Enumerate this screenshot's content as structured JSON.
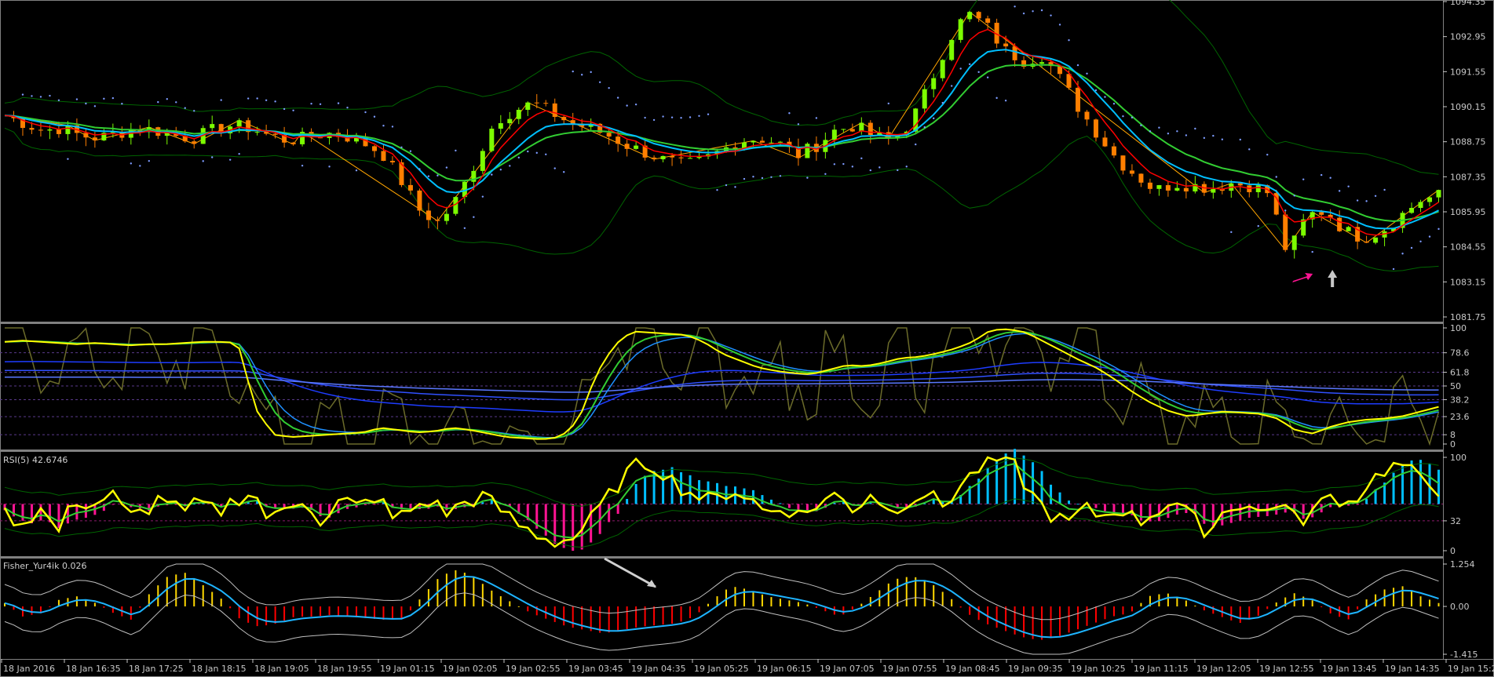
{
  "chart_data": {
    "type": "candlestick",
    "panels": [
      {
        "id": "price",
        "y_ticks": [
          "1094.35",
          "1092.95",
          "1091.55",
          "1090.15",
          "1088.75",
          "1087.35",
          "1085.95",
          "1084.55",
          "1083.15",
          "1081.75"
        ],
        "ylim": [
          1081.75,
          1094.35
        ]
      },
      {
        "id": "stoch",
        "y_ticks": [
          "100",
          "78.6",
          "61.8",
          "50",
          "38.2",
          "23.6",
          "8",
          "0"
        ],
        "ylim": [
          0,
          100
        ]
      },
      {
        "id": "rsi",
        "label": "RSI(5) 42.6746",
        "y_ticks": [
          "100",
          "32",
          "0"
        ],
        "ylim": [
          0,
          100
        ]
      },
      {
        "id": "fisher",
        "label": "Fisher_Yur4ik 0.026",
        "y_ticks": [
          "1.254",
          "0.00",
          "-1.415"
        ],
        "ylim": [
          -1.415,
          1.254
        ]
      }
    ],
    "x_ticks": [
      "18 Jan 2016",
      "18 Jan 16:35",
      "18 Jan 17:25",
      "18 Jan 18:15",
      "18 Jan 19:05",
      "18 Jan 19:55",
      "19 Jan 01:15",
      "19 Jan 02:05",
      "19 Jan 02:55",
      "19 Jan 03:45",
      "19 Jan 04:35",
      "19 Jan 05:25",
      "19 Jan 06:15",
      "19 Jan 07:05",
      "19 Jan 07:55",
      "19 Jan 08:45",
      "19 Jan 09:35",
      "19 Jan 10:25",
      "19 Jan 11:15",
      "19 Jan 12:05",
      "19 Jan 12:55",
      "19 Jan 13:45",
      "19 Jan 14:35",
      "19 Jan 15:25"
    ],
    "price_path": [
      1089.8,
      1089.5,
      1089.2,
      1089.3,
      1089.0,
      1088.9,
      1089.1,
      1089.3,
      1089.2,
      1089.0,
      1088.9,
      1089.2,
      1089.4,
      1089.3,
      1089.0,
      1088.8,
      1088.9,
      1089.1,
      1089.0,
      1088.7,
      1088.3,
      1087.2,
      1086.0,
      1085.5,
      1086.5,
      1088.0,
      1089.6,
      1090.0,
      1090.3,
      1089.9,
      1089.5,
      1089.3,
      1089.0,
      1088.6,
      1088.3,
      1088.0,
      1087.8,
      1088.0,
      1088.4,
      1088.8,
      1088.9,
      1088.7,
      1088.2,
      1088.6,
      1089.2,
      1089.4,
      1089.0,
      1088.8,
      1089.5,
      1091.0,
      1092.8,
      1093.9,
      1093.4,
      1092.4,
      1092.0,
      1092.2,
      1091.2,
      1090.0,
      1089.0,
      1088.0,
      1087.4,
      1086.8,
      1087.1,
      1087.0,
      1086.9,
      1087.1,
      1087.0,
      1086.7,
      1084.2,
      1085.8,
      1086.0,
      1085.2,
      1084.9,
      1085.2,
      1085.8,
      1086.4,
      1086.6
    ],
    "stoch_path": [
      88,
      89,
      88,
      87,
      86,
      87,
      86,
      85,
      86,
      86,
      87,
      88,
      88,
      87,
      30,
      8,
      6,
      7,
      8,
      9,
      10,
      14,
      12,
      10,
      11,
      14,
      12,
      9,
      6,
      5,
      4,
      6,
      20,
      60,
      85,
      97,
      96,
      95,
      94,
      88,
      78,
      72,
      66,
      63,
      61,
      60,
      64,
      68,
      67,
      70,
      74,
      75,
      78,
      82,
      88,
      98,
      99,
      96,
      88,
      80,
      72,
      65,
      55,
      44,
      35,
      28,
      24,
      26,
      28,
      27,
      26,
      22,
      12,
      9,
      15,
      19,
      21,
      22,
      24,
      28,
      32
    ],
    "rsi_path": [
      40,
      30,
      45,
      20,
      55,
      48,
      62,
      35,
      44,
      60,
      38,
      52,
      40,
      55,
      64,
      30,
      48,
      58,
      25,
      55,
      46,
      60,
      32,
      45,
      54,
      40,
      52,
      58,
      44,
      28,
      18,
      10,
      12,
      30,
      55,
      80,
      95,
      88,
      70,
      60,
      52,
      66,
      58,
      40,
      48,
      36,
      52,
      60,
      44,
      64,
      40,
      55,
      62,
      48,
      70,
      88,
      97,
      92,
      60,
      40,
      28,
      45,
      36,
      48,
      30,
      42,
      55,
      35,
      20,
      46,
      52,
      38,
      55,
      30,
      44,
      60,
      50,
      72,
      88,
      92,
      74,
      66
    ],
    "fisher_path": [
      0.1,
      -0.3,
      -0.2,
      0.2,
      0.3,
      0.1,
      -0.2,
      -0.4,
      0.4,
      0.9,
      1.0,
      0.6,
      0.2,
      -0.4,
      -0.6,
      -0.5,
      -0.3,
      -0.3,
      -0.25,
      -0.3,
      -0.35,
      -0.4,
      -0.35,
      0.3,
      0.9,
      1.1,
      0.8,
      0.4,
      0.1,
      -0.2,
      -0.4,
      -0.6,
      -0.7,
      -0.8,
      -0.7,
      -0.6,
      -0.55,
      -0.5,
      -0.3,
      0.2,
      0.6,
      0.5,
      0.3,
      0.2,
      0.1,
      -0.1,
      -0.3,
      0.0,
      0.4,
      0.8,
      0.9,
      0.7,
      0.3,
      -0.2,
      -0.5,
      -0.7,
      -0.9,
      -1.0,
      -0.9,
      -0.7,
      -0.5,
      -0.3,
      -0.2,
      0.3,
      0.4,
      0.2,
      -0.1,
      -0.3,
      -0.5,
      -0.3,
      0.1,
      0.4,
      0.2,
      -0.2,
      -0.4,
      0.2,
      0.5,
      0.6,
      0.3,
      0.1
    ]
  },
  "colors": {
    "bull": "#7cfc00",
    "bear": "#ff7f00",
    "ma_red": "#ff0000",
    "ma_blue": "#00bfff",
    "ma_green": "#32cd32",
    "band": "#006400",
    "sar": "#7d9bff",
    "zigzag": "#ffa500",
    "stoch_yellow": "#ffff00",
    "olive": "#6b6b2a",
    "fisher_pos": "#ffd700",
    "fisher_neg": "#ff0000",
    "hist_pos": "#00bfff",
    "hist_neg": "#ff1493"
  }
}
